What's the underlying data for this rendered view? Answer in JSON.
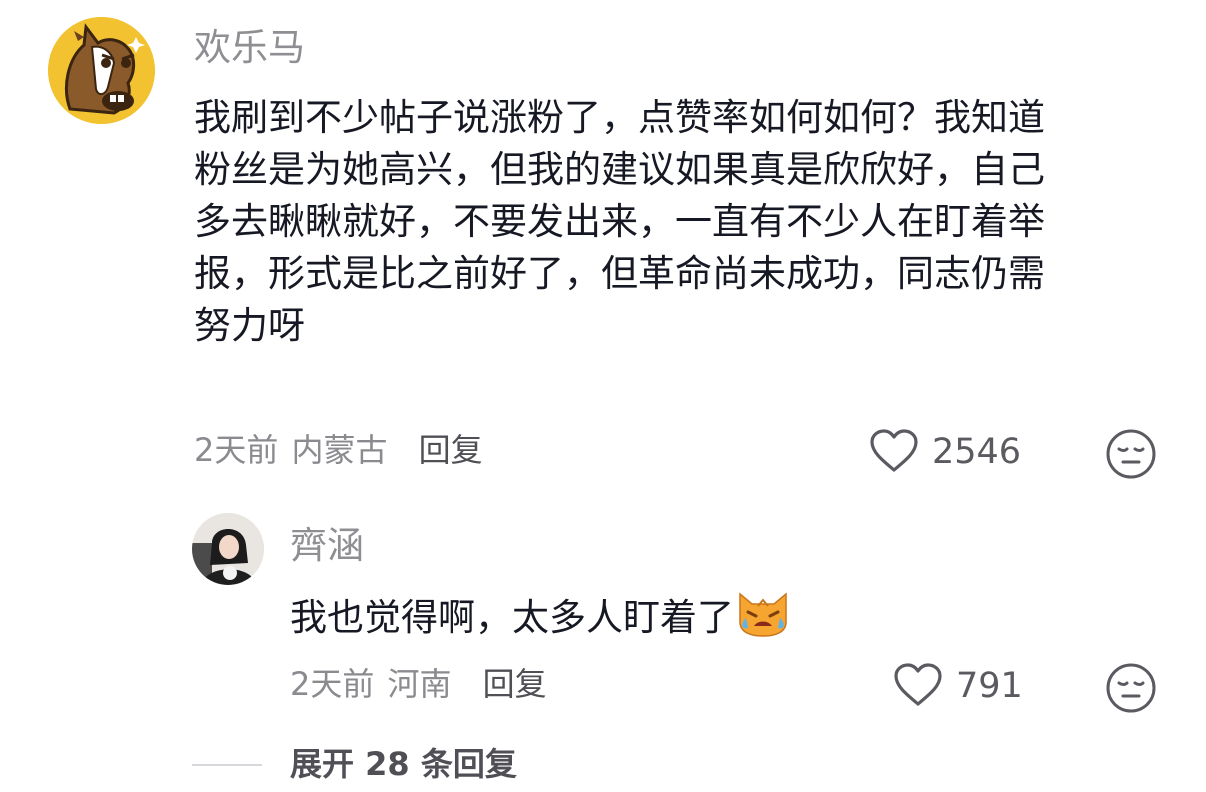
{
  "comment": {
    "username": "欢乐马",
    "text_lines": [
      "我刷到不少帖子说涨粉了，点赞率如何如何？我知道",
      "粉丝是为她高兴，但我的建议如果真是欣欣好，自己",
      "多去瞅瞅就好，不要发出来，一直有不少人在盯着举",
      "报，形式是比之前好了，但革命尚未成功，同志仍需",
      "努力呀"
    ],
    "time": "2天前",
    "location": "内蒙古",
    "reply_label": "回复",
    "like_count": "2546",
    "avatar_icon": "horse-avatar-icon",
    "like_icon": "heart-icon",
    "dislike_icon": "meh-face-icon"
  },
  "reply": {
    "username": "齊涵",
    "text": "我也觉得啊，太多人盯着了",
    "emoji_icon": "crying-cat-emoji-icon",
    "time": "2天前",
    "location": "河南",
    "reply_label": "回复",
    "like_count": "791",
    "avatar_icon": "user-photo-avatar",
    "like_icon": "heart-icon",
    "dislike_icon": "meh-face-icon"
  },
  "expand": {
    "label": "展开 28 条回复"
  },
  "colors": {
    "primary_text": "#161823",
    "secondary_text": "#8a8a8f",
    "avatar_bg": "#f3c230"
  }
}
